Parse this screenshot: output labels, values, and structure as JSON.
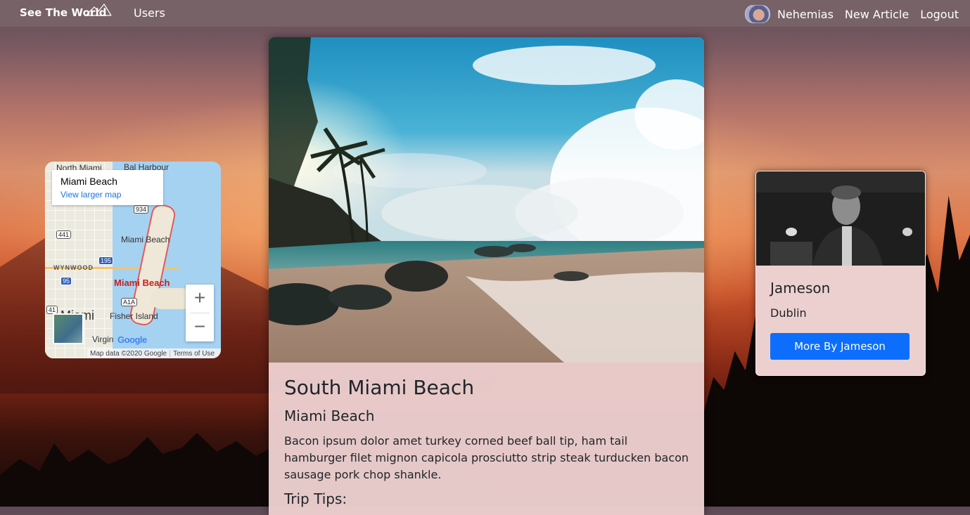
{
  "navbar": {
    "brand": "See The World",
    "users_link": "Users",
    "username": "Nehemias",
    "new_article": "New Article",
    "logout": "Logout"
  },
  "map": {
    "info_title": "Miami Beach",
    "info_link": "View larger map",
    "labels": {
      "north_miami": "North Miami",
      "bal_harbour": "Bal Harbour",
      "miami_beach": "Miami Beach",
      "miami_beach_red": "Miami Beach",
      "wynwood": "WYNWOOD",
      "fisher_island": "Fisher Island",
      "miami": "Miami",
      "virgin": "Virgin"
    },
    "shields": {
      "s934": "934",
      "s441": "441",
      "s195": "195",
      "s95": "95",
      "sA1A": "A1A",
      "s41": "41"
    },
    "zoom_in": "+",
    "zoom_out": "−",
    "google": "Google",
    "attribution": "Map data ©2020 Google",
    "terms": "Terms of Use"
  },
  "article": {
    "title": "South Miami Beach",
    "location": "Miami Beach",
    "body": "Bacon ipsum dolor amet turkey corned beef ball tip, ham tail hamburger filet mignon capicola prosciutto strip steak turducken bacon sausage pork chop shankle.",
    "tips_heading": "Trip Tips:"
  },
  "author": {
    "name": "Jameson",
    "city": "Dublin",
    "button": "More By Jameson"
  },
  "colors": {
    "navbar": "#7a6468",
    "card_bg": "#ecd0cf",
    "button": "#0d6efd",
    "map_link": "#1a73e8",
    "map_red": "#c5221f"
  }
}
